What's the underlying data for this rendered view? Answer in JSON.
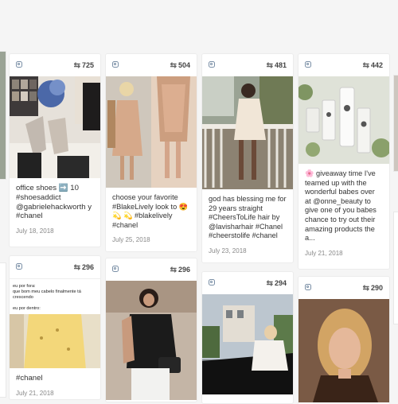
{
  "cards": [
    {
      "id": "c1",
      "likes": "725",
      "caption": "office shoes ➡️ 10 #shoesaddict @gabrielehackworth y #chanel",
      "date": "July 18, 2018",
      "photo": {
        "description_icon": "photo-shoes",
        "bg": "#cfc7bd"
      }
    },
    {
      "id": "c2",
      "likes": "504",
      "caption": "choose your favorite #BlakeLively look to 😍 💫 💫 #blakelively #chanel",
      "date": "July 25, 2018",
      "photo": {
        "description_icon": "photo-dresses",
        "bg": "#d9c3ad"
      }
    },
    {
      "id": "c3",
      "likes": "481",
      "caption": "god has blessing me for 29 years straight #CheersToLife hair by @lavisharhair #Chanel #cheerstolife #chanel",
      "date": "July 23, 2018",
      "photo": {
        "description_icon": "photo-porch",
        "bg": "#a7a99a"
      }
    },
    {
      "id": "c4",
      "likes": "442",
      "caption": "🌸 giveaway time I've teamed up with the wonderful babes over at @onne_beauty to give one of you babes chance to try out their amazing products the a...",
      "date": "July 21, 2018",
      "photo": {
        "description_icon": "photo-products",
        "bg": "#d8dbd2"
      }
    },
    {
      "id": "c5",
      "likes": "296",
      "caption": "#chanel",
      "date": "July 21, 2018",
      "photo": {
        "description_icon": "photo-meme",
        "bg": "#ffffff",
        "text_top": "eu por fora:\nque bom meu cabelo finalmente tá crescendo",
        "text_mid": "eu por dentro:"
      }
    },
    {
      "id": "c6",
      "likes": "296",
      "caption": "",
      "date": "",
      "photo": {
        "description_icon": "photo-blackdress",
        "bg": "#b9a898"
      }
    },
    {
      "id": "c7",
      "likes": "294",
      "caption": "",
      "date": "",
      "photo": {
        "description_icon": "photo-car",
        "bg": "#8e9aa3"
      }
    },
    {
      "id": "c8",
      "likes": "290",
      "caption": "",
      "date": "",
      "photo": {
        "description_icon": "photo-portrait",
        "bg": "#7a5a45"
      }
    }
  ],
  "colors": {
    "page_bg": "#f5f5f5",
    "card_bg": "#ffffff",
    "accent_icon": "#7a8fa6"
  }
}
